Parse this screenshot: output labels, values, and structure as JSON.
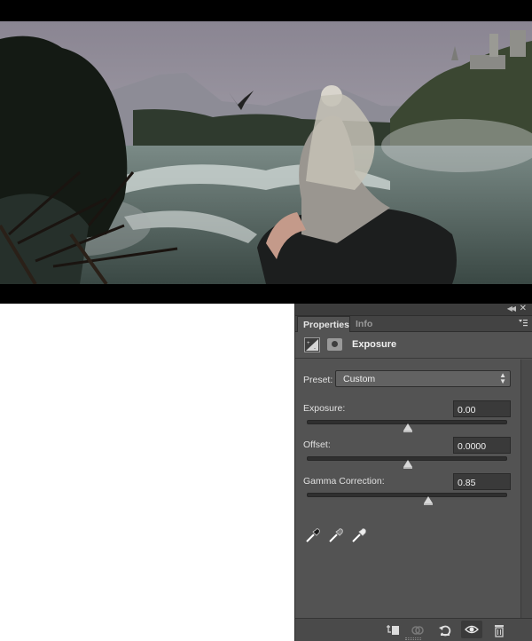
{
  "canvas": {
    "description_icon": "photo-canvas"
  },
  "panel": {
    "tabs": [
      "Properties",
      "Info"
    ],
    "active_tab": "Properties",
    "adjustment_title": "Exposure",
    "preset": {
      "label": "Preset:",
      "value": "Custom"
    },
    "sliders": [
      {
        "label": "Exposure:",
        "value": "0.00",
        "position": 0.5
      },
      {
        "label": "Offset:",
        "value": "0.0000",
        "position": 0.5
      },
      {
        "label": "Gamma Correction:",
        "value": "0.85",
        "position": 0.6
      }
    ],
    "eyedroppers": [
      "black-point-eyedropper-icon",
      "gray-point-eyedropper-icon",
      "white-point-eyedropper-icon"
    ],
    "footer_icons": [
      "clip-to-layer-icon",
      "view-previous-state-icon",
      "reset-icon",
      "visibility-eye-icon",
      "delete-icon"
    ]
  },
  "colors": {
    "panel_bg": "#535353",
    "canvas_bg": "#000000"
  }
}
